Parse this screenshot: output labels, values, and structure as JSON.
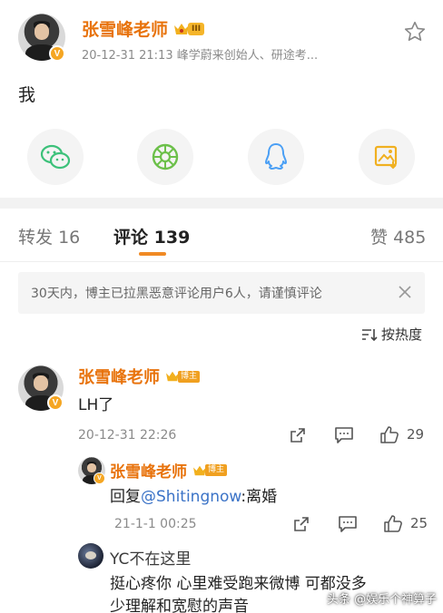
{
  "post": {
    "author": "张雪峰老师",
    "level": "III",
    "verified_mark": "V",
    "meta": "20-12-31 21:13  峰学蔚来创始人、研途考...",
    "content": "我"
  },
  "share": {
    "items": [
      "wechat-icon",
      "moments-icon",
      "qq-icon",
      "qzone-icon"
    ]
  },
  "tabs": {
    "repost_label": "转发",
    "repost_count": "16",
    "comment_label": "评论",
    "comment_count": "139",
    "like_label": "赞",
    "like_count": "485"
  },
  "notice": {
    "text": "30天内，博主已拉黑恶意评论用户6人，请谨慎评论"
  },
  "sort": {
    "label": "按热度"
  },
  "comments": [
    {
      "author": "张雪峰老师",
      "badge": "博主",
      "text": "LH了",
      "time": "20-12-31 22:26",
      "likes": "29",
      "reply": {
        "author": "张雪峰老师",
        "badge": "博主",
        "text_prefix": "回复",
        "mention": "@Shitingnow",
        "text_suffix": ":离婚",
        "time": "21-1-1 00:25",
        "likes": "25"
      }
    },
    {
      "author": "YC不在这里",
      "line1": "挺心疼你 心里难受跑来微博 可都没多",
      "line2": "少理解和宽慰的声音"
    }
  ],
  "watermark": "头条 @娱乐个神算子",
  "colors": {
    "brand_orange": "#e8730c",
    "accent_orange": "#f08a24",
    "link_blue": "#3b73c7"
  }
}
